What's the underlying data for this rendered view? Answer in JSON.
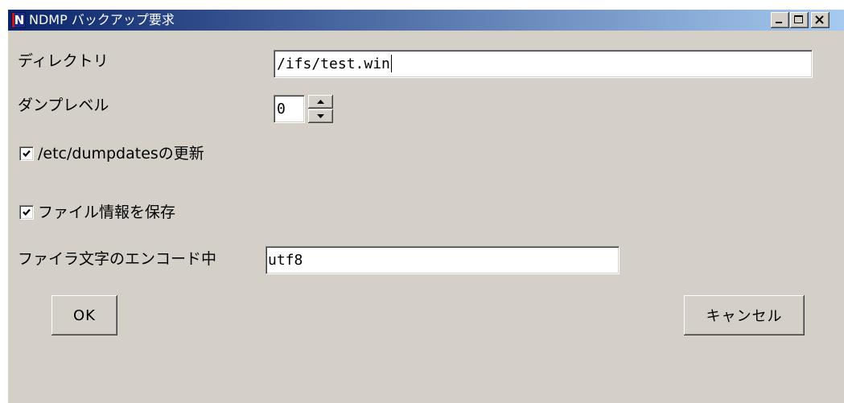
{
  "window": {
    "title": "NDMP バックアップ要求",
    "app_icon_letter": "N",
    "icons": {
      "app": "n-app-icon",
      "minimize": "minimize-icon",
      "maximize": "maximize-icon",
      "close": "close-icon"
    }
  },
  "form": {
    "directory": {
      "label": "ディレクトリ",
      "value": "/ifs/test.win"
    },
    "dump_level": {
      "label": "ダンプレベル",
      "value": "0",
      "icons": {
        "increment": "arrow-up-icon",
        "decrement": "arrow-down-icon"
      }
    },
    "update_dumpdates": {
      "label": "/etc/dumpdatesの更新",
      "checked": true
    },
    "save_file_info": {
      "label": "ファイル情報を保存",
      "checked": true
    },
    "filer_encoding": {
      "label": "ファイラ文字のエンコード中",
      "value": "utf8"
    }
  },
  "buttons": {
    "ok": "OK",
    "cancel": "キャンセル"
  },
  "colors": {
    "dialog_background": "#d4d0c8",
    "titlebar_start": "#0a246a",
    "titlebar_end": "#a6caf0",
    "title_text": "#ffffff",
    "field_background": "#ffffff"
  }
}
